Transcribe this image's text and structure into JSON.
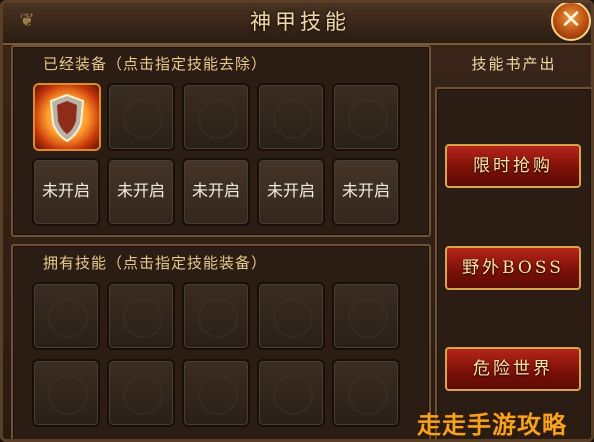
{
  "window": {
    "title": "神甲技能",
    "close_icon": "close-x-icon"
  },
  "equipped_panel": {
    "title": "已经装备（点击指定技能去除）",
    "row1": [
      {
        "state": "equipped",
        "icon": "shield-skill-icon"
      },
      {
        "state": "empty"
      },
      {
        "state": "empty"
      },
      {
        "state": "empty"
      },
      {
        "state": "empty"
      }
    ],
    "row2": [
      {
        "state": "locked",
        "label": "未开启"
      },
      {
        "state": "locked",
        "label": "未开启"
      },
      {
        "state": "locked",
        "label": "未开启"
      },
      {
        "state": "locked",
        "label": "未开启"
      },
      {
        "state": "locked",
        "label": "未开启"
      }
    ]
  },
  "owned_panel": {
    "title": "拥有技能（点击指定技能装备）",
    "slot_count": 10
  },
  "source_panel": {
    "title": "技能书产出",
    "buttons": [
      "限时抢购",
      "野外BOSS",
      "危险世界"
    ]
  },
  "watermark": "走走手游攻略",
  "colors": {
    "accent": "#e7c98d",
    "button": "#9c1a10",
    "watermark": "#f5a21f"
  }
}
